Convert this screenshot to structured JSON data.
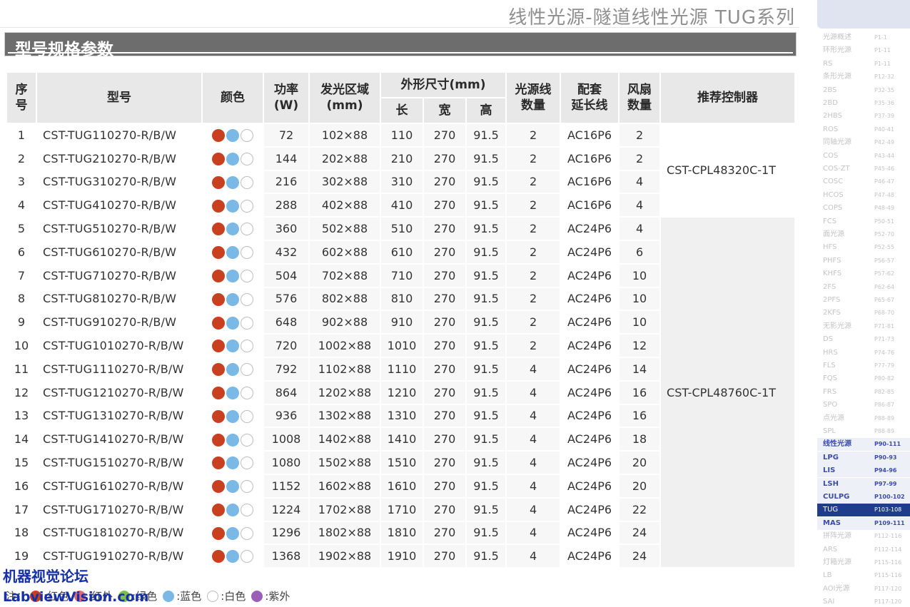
{
  "header": {
    "title": "线性光源-隧道线性光源 TUG系列"
  },
  "section": {
    "title": "型号规格参数"
  },
  "table": {
    "headers": {
      "index": "序号",
      "model": "型号",
      "color": "颜色",
      "power": "功率\n(W)",
      "emit_area": "发光区域\n(mm)",
      "dimensions": "外形尺寸(mm)",
      "length": "长",
      "width": "宽",
      "height": "高",
      "cable_count": "光源线\n数量",
      "extension": "配套\n延长线",
      "fan_count": "风扇\n数量",
      "controller": "推荐控制器"
    },
    "rows": [
      {
        "idx": "1",
        "model": "CST-TUG110270-R/B/W",
        "power": "72",
        "area": "102×88",
        "l": "110",
        "w": "270",
        "h": "91.5",
        "cable": "2",
        "ext": "AC16P6",
        "fan": "2"
      },
      {
        "idx": "2",
        "model": "CST-TUG210270-R/B/W",
        "power": "144",
        "area": "202×88",
        "l": "210",
        "w": "270",
        "h": "91.5",
        "cable": "2",
        "ext": "AC16P6",
        "fan": "2"
      },
      {
        "idx": "3",
        "model": "CST-TUG310270-R/B/W",
        "power": "216",
        "area": "302×88",
        "l": "310",
        "w": "270",
        "h": "91.5",
        "cable": "2",
        "ext": "AC16P6",
        "fan": "4"
      },
      {
        "idx": "4",
        "model": "CST-TUG410270-R/B/W",
        "power": "288",
        "area": "402×88",
        "l": "410",
        "w": "270",
        "h": "91.5",
        "cable": "2",
        "ext": "AC16P6",
        "fan": "4"
      },
      {
        "idx": "5",
        "model": "CST-TUG510270-R/B/W",
        "power": "360",
        "area": "502×88",
        "l": "510",
        "w": "270",
        "h": "91.5",
        "cable": "2",
        "ext": "AC24P6",
        "fan": "4"
      },
      {
        "idx": "6",
        "model": "CST-TUG610270-R/B/W",
        "power": "432",
        "area": "602×88",
        "l": "610",
        "w": "270",
        "h": "91.5",
        "cable": "2",
        "ext": "AC24P6",
        "fan": "6"
      },
      {
        "idx": "7",
        "model": "CST-TUG710270-R/B/W",
        "power": "504",
        "area": "702×88",
        "l": "710",
        "w": "270",
        "h": "91.5",
        "cable": "2",
        "ext": "AC24P6",
        "fan": "10"
      },
      {
        "idx": "8",
        "model": "CST-TUG810270-R/B/W",
        "power": "576",
        "area": "802×88",
        "l": "810",
        "w": "270",
        "h": "91.5",
        "cable": "2",
        "ext": "AC24P6",
        "fan": "10"
      },
      {
        "idx": "9",
        "model": "CST-TUG910270-R/B/W",
        "power": "648",
        "area": "902×88",
        "l": "910",
        "w": "270",
        "h": "91.5",
        "cable": "2",
        "ext": "AC24P6",
        "fan": "10"
      },
      {
        "idx": "10",
        "model": "CST-TUG1010270-R/B/W",
        "power": "720",
        "area": "1002×88",
        "l": "1010",
        "w": "270",
        "h": "91.5",
        "cable": "2",
        "ext": "AC24P6",
        "fan": "12"
      },
      {
        "idx": "11",
        "model": "CST-TUG1110270-R/B/W",
        "power": "792",
        "area": "1102×88",
        "l": "1110",
        "w": "270",
        "h": "91.5",
        "cable": "4",
        "ext": "AC24P6",
        "fan": "14"
      },
      {
        "idx": "12",
        "model": "CST-TUG1210270-R/B/W",
        "power": "864",
        "area": "1202×88",
        "l": "1210",
        "w": "270",
        "h": "91.5",
        "cable": "4",
        "ext": "AC24P6",
        "fan": "16"
      },
      {
        "idx": "13",
        "model": "CST-TUG1310270-R/B/W",
        "power": "936",
        "area": "1302×88",
        "l": "1310",
        "w": "270",
        "h": "91.5",
        "cable": "4",
        "ext": "AC24P6",
        "fan": "16"
      },
      {
        "idx": "14",
        "model": "CST-TUG1410270-R/B/W",
        "power": "1008",
        "area": "1402×88",
        "l": "1410",
        "w": "270",
        "h": "91.5",
        "cable": "4",
        "ext": "AC24P6",
        "fan": "18"
      },
      {
        "idx": "15",
        "model": "CST-TUG1510270-R/B/W",
        "power": "1080",
        "area": "1502×88",
        "l": "1510",
        "w": "270",
        "h": "91.5",
        "cable": "4",
        "ext": "AC24P6",
        "fan": "20"
      },
      {
        "idx": "16",
        "model": "CST-TUG1610270-R/B/W",
        "power": "1152",
        "area": "1602×88",
        "l": "1610",
        "w": "270",
        "h": "91.5",
        "cable": "4",
        "ext": "AC24P6",
        "fan": "20"
      },
      {
        "idx": "17",
        "model": "CST-TUG1710270-R/B/W",
        "power": "1224",
        "area": "1702×88",
        "l": "1710",
        "w": "270",
        "h": "91.5",
        "cable": "4",
        "ext": "AC24P6",
        "fan": "22"
      },
      {
        "idx": "18",
        "model": "CST-TUG1810270-R/B/W",
        "power": "1296",
        "area": "1802×88",
        "l": "1810",
        "w": "270",
        "h": "91.5",
        "cable": "4",
        "ext": "AC24P6",
        "fan": "24"
      },
      {
        "idx": "19",
        "model": "CST-TUG1910270-R/B/W",
        "power": "1368",
        "area": "1902×88",
        "l": "1910",
        "w": "270",
        "h": "91.5",
        "cable": "4",
        "ext": "AC24P6",
        "fan": "24"
      }
    ],
    "controllers": [
      {
        "name": "CST-CPL48320C-1T",
        "row_span": 4
      },
      {
        "name": "CST-CPL48760C-1T",
        "row_span": 15
      }
    ],
    "color_dots": [
      "red",
      "blue",
      "white"
    ]
  },
  "legend": {
    "prefix": "注：",
    "items": [
      {
        "label": ":红色",
        "color": "#c8401f"
      },
      {
        "label": ":红外",
        "color": "#e06d6d"
      },
      {
        "label": ":绿色",
        "color": "#7cc04a"
      },
      {
        "label": ":蓝色",
        "color": "#7ab8e6"
      },
      {
        "label": ":白色",
        "color": "#ffffff"
      },
      {
        "label": ":紫外",
        "color": "#9b5fb5"
      }
    ]
  },
  "watermark": {
    "line1": "机器视觉论坛",
    "line2": "LabviewVision.com"
  },
  "sidebar": {
    "items": [
      {
        "name": "光源概述",
        "pages": "P1-1"
      },
      {
        "name": "环形光源",
        "pages": "P1-11"
      },
      {
        "name": "RS",
        "pages": "P1-11"
      },
      {
        "name": "条形光源",
        "pages": "P12-32"
      },
      {
        "name": "2BS",
        "pages": "P32-35"
      },
      {
        "name": "2BD",
        "pages": "P35-36"
      },
      {
        "name": "2HBS",
        "pages": "P37-39"
      },
      {
        "name": "ROS",
        "pages": "P40-41"
      },
      {
        "name": "同轴光源",
        "pages": "P42-49"
      },
      {
        "name": "COS",
        "pages": "P43-44"
      },
      {
        "name": "COS-ZT",
        "pages": "P45-46"
      },
      {
        "name": "COSC",
        "pages": "P46-47"
      },
      {
        "name": "HCOS",
        "pages": "P47-48"
      },
      {
        "name": "COPS",
        "pages": "P48-49"
      },
      {
        "name": "FCS",
        "pages": "P50-51"
      },
      {
        "name": "面光源",
        "pages": "P52-70"
      },
      {
        "name": "HFS",
        "pages": "P52-55"
      },
      {
        "name": "PHFS",
        "pages": "P56-57"
      },
      {
        "name": "KHFS",
        "pages": "P57-62"
      },
      {
        "name": "2FS",
        "pages": "P62-64"
      },
      {
        "name": "2PFS",
        "pages": "P65-67"
      },
      {
        "name": "2KFS",
        "pages": "P68-70"
      },
      {
        "name": "无影光源",
        "pages": "P71-81"
      },
      {
        "name": "DS",
        "pages": "P71-73"
      },
      {
        "name": "HRS",
        "pages": "P74-76"
      },
      {
        "name": "FLS",
        "pages": "P77-79"
      },
      {
        "name": "FQS",
        "pages": "P80-82"
      },
      {
        "name": "FRS",
        "pages": "P82-85"
      },
      {
        "name": "SPO",
        "pages": "P86-87"
      },
      {
        "name": "点光源",
        "pages": "P88-89"
      },
      {
        "name": "SPL",
        "pages": "P88-89"
      },
      {
        "name": "线性光源",
        "pages": "P90-111",
        "group": true
      },
      {
        "name": "LPG",
        "pages": "P90-93",
        "group": true
      },
      {
        "name": "LIS",
        "pages": "P94-96",
        "group": true
      },
      {
        "name": "LSH",
        "pages": "P97-99",
        "group": true
      },
      {
        "name": "CULPG",
        "pages": "P100-102",
        "group": true
      },
      {
        "name": "TUG",
        "pages": "P103-108",
        "active": true
      },
      {
        "name": "MAS",
        "pages": "P109-111",
        "group": true
      },
      {
        "name": "拼阵光源",
        "pages": "P112-116"
      },
      {
        "name": "ARS",
        "pages": "P112-114"
      },
      {
        "name": "灯箱光源",
        "pages": "P115-116"
      },
      {
        "name": "LB",
        "pages": "P115-116"
      },
      {
        "name": "AOI光源",
        "pages": "P117-120"
      },
      {
        "name": "SAI",
        "pages": "P117-120"
      }
    ]
  }
}
